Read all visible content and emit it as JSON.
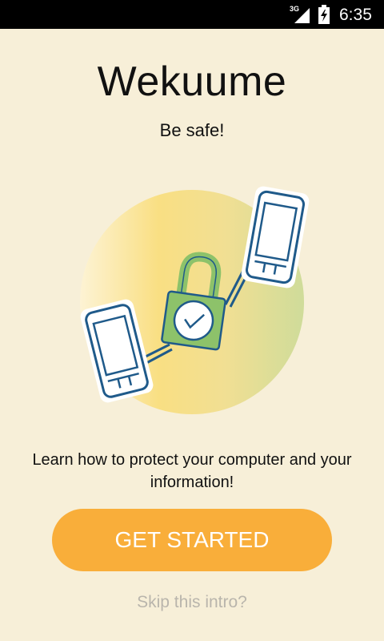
{
  "status_bar": {
    "network_label": "3G",
    "time": "6:35"
  },
  "app": {
    "title": "Wekuume",
    "tagline": "Be safe!"
  },
  "main": {
    "illustration_icons": [
      "phone-icon",
      "padlock-icon",
      "checkmark-icon",
      "phone-icon"
    ],
    "description": "Learn how to protect your computer and your information!",
    "get_started_label": "GET STARTED",
    "skip_label": "Skip this intro?"
  },
  "colors": {
    "background": "#f7efd8",
    "accent": "#f9ae3a",
    "lock_green": "#8dc26a",
    "phone_outline": "#1f5a8a",
    "skip_text": "#b9b5ac"
  }
}
